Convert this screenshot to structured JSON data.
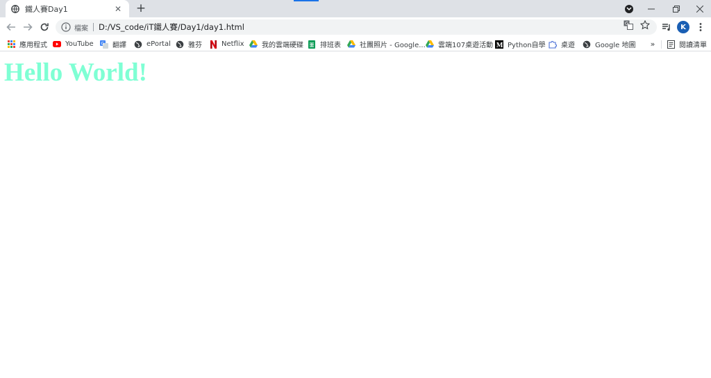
{
  "tab": {
    "title": "鐵人賽Day1",
    "favicon_icon": "globe-icon",
    "close_glyph": "✕"
  },
  "newtab_glyph": "+",
  "window_controls": {
    "minimize_glyph": "—",
    "restore_glyph": "❐",
    "close_glyph": "✕"
  },
  "omnibox": {
    "security_label": "檔案",
    "url": "D:/VS_code/iT鐵人賽/Day1/day1.html"
  },
  "profile": {
    "initial": "K",
    "color": "#1a5fb4"
  },
  "bookmarks": [
    {
      "label": "應用程式",
      "icon": "apps-grid-icon"
    },
    {
      "label": "YouTube",
      "icon": "youtube-icon"
    },
    {
      "label": "翻譯",
      "icon": "translate-icon"
    },
    {
      "label": "ePortal",
      "icon": "globe-icon"
    },
    {
      "label": "雅芬",
      "icon": "globe-icon"
    },
    {
      "label": "Netflix",
      "icon": "netflix-icon"
    },
    {
      "label": "我的雲端硬碟",
      "icon": "google-drive-icon"
    },
    {
      "label": "排班表",
      "icon": "google-sheets-icon"
    },
    {
      "label": "社團照片 - Google...",
      "icon": "google-drive-icon"
    },
    {
      "label": "雲端107桌遊活動",
      "icon": "google-drive-icon"
    },
    {
      "label": "Python自學",
      "icon": "medium-icon"
    },
    {
      "label": "桌遊",
      "icon": "puzzle-icon"
    },
    {
      "label": "Google 地圖",
      "icon": "globe-icon"
    }
  ],
  "bookmarks_more_glyph": "»",
  "reading_list_label": "閱讀清單",
  "page": {
    "heading": "Hello World!",
    "heading_color": "#7fffd4"
  }
}
